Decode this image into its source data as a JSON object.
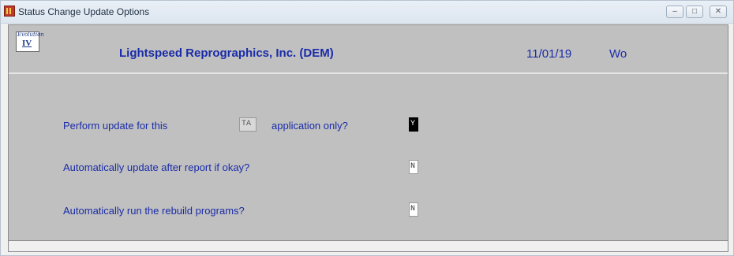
{
  "window": {
    "title": "Status Change Update Options",
    "minimize_glyph": "–",
    "maximize_glyph": "□",
    "close_glyph": "✕"
  },
  "header": {
    "logo_script": "Evolution",
    "logo_mark": "IV",
    "company": "Lightspeed Reprographics, Inc. (DEM)",
    "date": "11/01/19",
    "user": "Wo"
  },
  "form": {
    "perform_label_prefix": "Perform update for this",
    "app_code": "TA",
    "perform_label_suffix": "application only?",
    "perform_value": "Y",
    "auto_update_label": "Automatically update after report if okay?",
    "auto_update_value": "N",
    "rebuild_label": "Automatically run the rebuild programs?",
    "rebuild_value": "N"
  }
}
